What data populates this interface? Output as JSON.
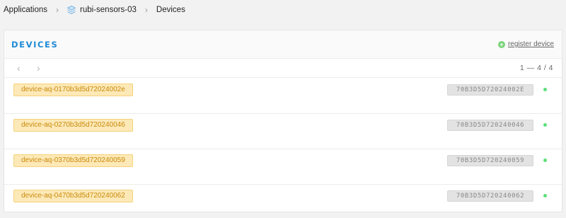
{
  "breadcrumb": {
    "applications": "Applications",
    "app": "rubi-sensors-03",
    "page": "Devices",
    "app_icon": "stack-icon"
  },
  "card": {
    "title": "DEVICES",
    "register_label": "register device",
    "page_count": "1 — 4 / 4"
  },
  "devices": [
    {
      "id": "device-aq-0170b3d5d72024002e",
      "eui": "70B3D5D72024002E",
      "status": "online"
    },
    {
      "id": "device-aq-0270b3d5d720240046",
      "eui": "70B3D5D720240046",
      "status": "online"
    },
    {
      "id": "device-aq-0370b3d5d720240059",
      "eui": "70B3D5D720240059",
      "status": "online"
    },
    {
      "id": "device-aq-0470b3d5d720240062",
      "eui": "70B3D5D720240062",
      "status": "online"
    }
  ],
  "colors": {
    "accent": "#1f8ad6",
    "device_tag_bg": "#fde9b8",
    "device_tag_text": "#c98a0a",
    "status_online": "#5ee07a"
  }
}
